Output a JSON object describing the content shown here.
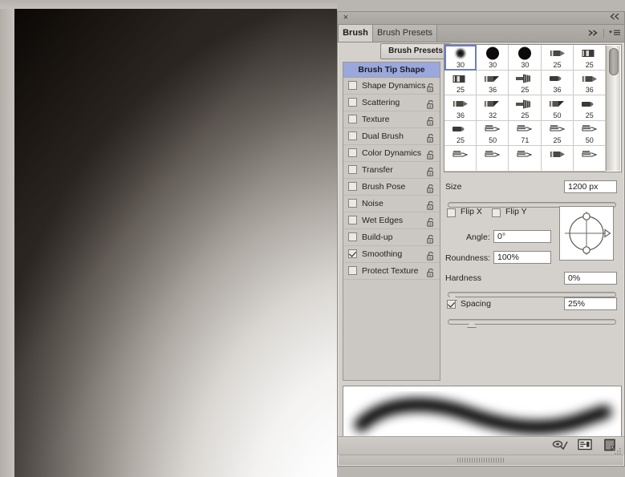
{
  "window": {
    "close_icon": "×",
    "collapse_icon": "»"
  },
  "tabs": [
    {
      "label": "Brush",
      "active": true
    },
    {
      "label": "Brush Presets",
      "active": false
    }
  ],
  "tab_icons": {
    "forward_icon": "▶▶",
    "menu_icon": "▾≡"
  },
  "toolbar": {
    "brush_presets_button": "Brush Presets"
  },
  "options": {
    "header": "Brush Tip Shape",
    "items": [
      {
        "label": "Shape Dynamics",
        "checked": false,
        "locked": true
      },
      {
        "label": "Scattering",
        "checked": false,
        "locked": true
      },
      {
        "label": "Texture",
        "checked": false,
        "locked": true
      },
      {
        "label": "Dual Brush",
        "checked": false,
        "locked": true
      },
      {
        "label": "Color Dynamics",
        "checked": false,
        "locked": true
      },
      {
        "label": "Transfer",
        "checked": false,
        "locked": true
      },
      {
        "label": "Brush Pose",
        "checked": false,
        "locked": true
      },
      {
        "label": "Noise",
        "checked": false,
        "locked": true
      },
      {
        "label": "Wet Edges",
        "checked": false,
        "locked": true
      },
      {
        "label": "Build-up",
        "checked": false,
        "locked": true
      },
      {
        "label": "Smoothing",
        "checked": true,
        "locked": true
      },
      {
        "label": "Protect Texture",
        "checked": false,
        "locked": true
      }
    ]
  },
  "brush_grid": {
    "selected_index": 0,
    "rows": [
      [
        {
          "size": "30",
          "shape": "soft-round"
        },
        {
          "size": "30",
          "shape": "hard-round"
        },
        {
          "size": "30",
          "shape": "hard-round"
        },
        {
          "size": "25",
          "shape": "flat-tip"
        },
        {
          "size": "25",
          "shape": "square-tip"
        }
      ],
      [
        {
          "size": "25",
          "shape": "square-tip"
        },
        {
          "size": "36",
          "shape": "angled-tip"
        },
        {
          "size": "25",
          "shape": "fan-tip"
        },
        {
          "size": "36",
          "shape": "round-point"
        },
        {
          "size": "36",
          "shape": "flat-tip"
        }
      ],
      [
        {
          "size": "36",
          "shape": "flat-tip"
        },
        {
          "size": "32",
          "shape": "angled-tip"
        },
        {
          "size": "25",
          "shape": "fan-tip"
        },
        {
          "size": "50",
          "shape": "angled-tip"
        },
        {
          "size": "25",
          "shape": "round-point"
        }
      ],
      [
        {
          "size": "25",
          "shape": "round-point"
        },
        {
          "size": "50",
          "shape": "pencil-tip"
        },
        {
          "size": "71",
          "shape": "pencil-tip"
        },
        {
          "size": "25",
          "shape": "pencil-tip"
        },
        {
          "size": "50",
          "shape": "pencil-tip"
        }
      ],
      [
        {
          "size": "",
          "shape": "pencil-tip"
        },
        {
          "size": "",
          "shape": "pencil-tip"
        },
        {
          "size": "",
          "shape": "pencil-tip"
        },
        {
          "size": "",
          "shape": "flat-tip"
        },
        {
          "size": "",
          "shape": "pencil-tip"
        }
      ]
    ]
  },
  "controls": {
    "size": {
      "label": "Size",
      "value": "1200 px",
      "slider_percent": 91
    },
    "flip_x": {
      "label": "Flip X",
      "checked": false
    },
    "flip_y": {
      "label": "Flip Y",
      "checked": false
    },
    "angle": {
      "label": "Angle:",
      "value": "0°"
    },
    "roundness": {
      "label": "Roundness:",
      "value": "100%"
    },
    "hardness": {
      "label": "Hardness",
      "value": "0%",
      "slider_percent": 0
    },
    "spacing": {
      "label": "Spacing",
      "value": "25%",
      "checked": true,
      "slider_percent": 12
    }
  },
  "footer": {
    "icons": [
      {
        "name": "toggle-brush-settings-icon"
      },
      {
        "name": "open-preset-manager-icon"
      },
      {
        "name": "new-brush-icon"
      }
    ]
  },
  "colors": {
    "panel_bg": "#d4d1cc",
    "header_accent": "#9aa8dd",
    "selection_outline": "#6b7fc4",
    "text": "#24221f",
    "field_bg": "#ffffff"
  }
}
